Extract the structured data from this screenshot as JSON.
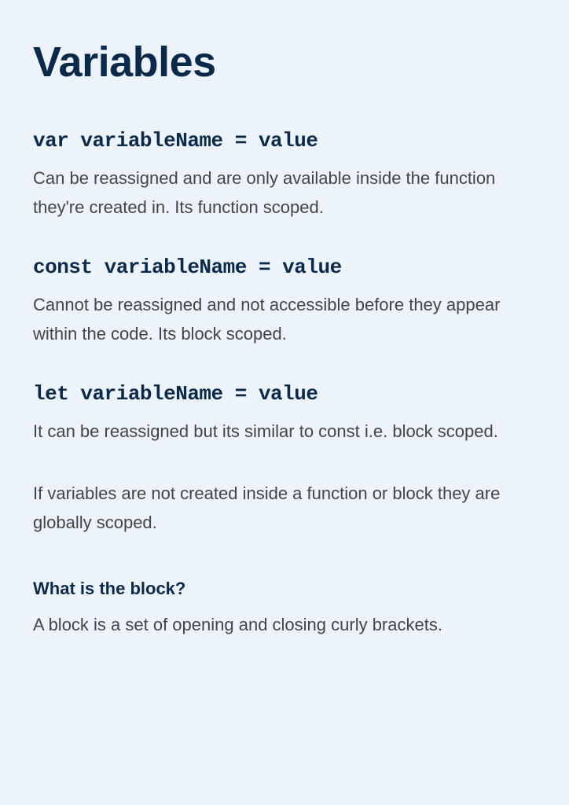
{
  "title": "Variables",
  "sections": [
    {
      "code": "var variableName = value",
      "description": "Can be reassigned and are only available inside the function they're created in. Its function scoped."
    },
    {
      "code": "const variableName = value",
      "description": "Cannot be reassigned and not accessible before they appear within the code. Its block scoped."
    },
    {
      "code": "let variableName = value",
      "description": "It can be reassigned but its similar to const i.e. block scoped."
    }
  ],
  "note": "If variables are not created inside a function or block they are globally scoped.",
  "sub": {
    "heading": "What is the block?",
    "text": "A block is a set of opening and closing curly brackets."
  }
}
